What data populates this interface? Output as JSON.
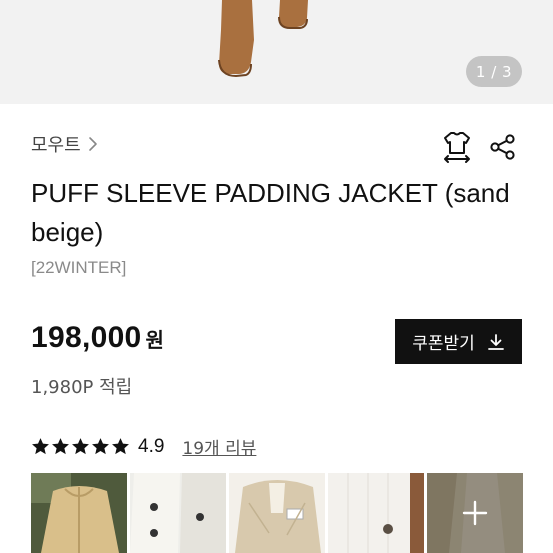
{
  "gallery": {
    "counter": "1 / 3"
  },
  "brand": {
    "name": "모우트"
  },
  "product": {
    "title": "PUFF SLEEVE PADDING JACKET (sand beige)",
    "season": "[22WINTER]",
    "price": "198,000",
    "currency": "원",
    "points": "1,980P 적립"
  },
  "coupon": {
    "label": "쿠폰받기"
  },
  "rating": {
    "stars": 5,
    "value": "4.9",
    "reviews_label": "19개 리뷰"
  },
  "icons": {
    "brand_chevron": "chevron-right-icon",
    "size_guide": "size-guide-shirt-icon",
    "share": "share-icon",
    "download": "download-icon",
    "more_photos": "plus-icon"
  },
  "colors": {
    "accent": "#111111",
    "muted": "#8a8a8a",
    "counter_bg": "#c4c4c4"
  }
}
